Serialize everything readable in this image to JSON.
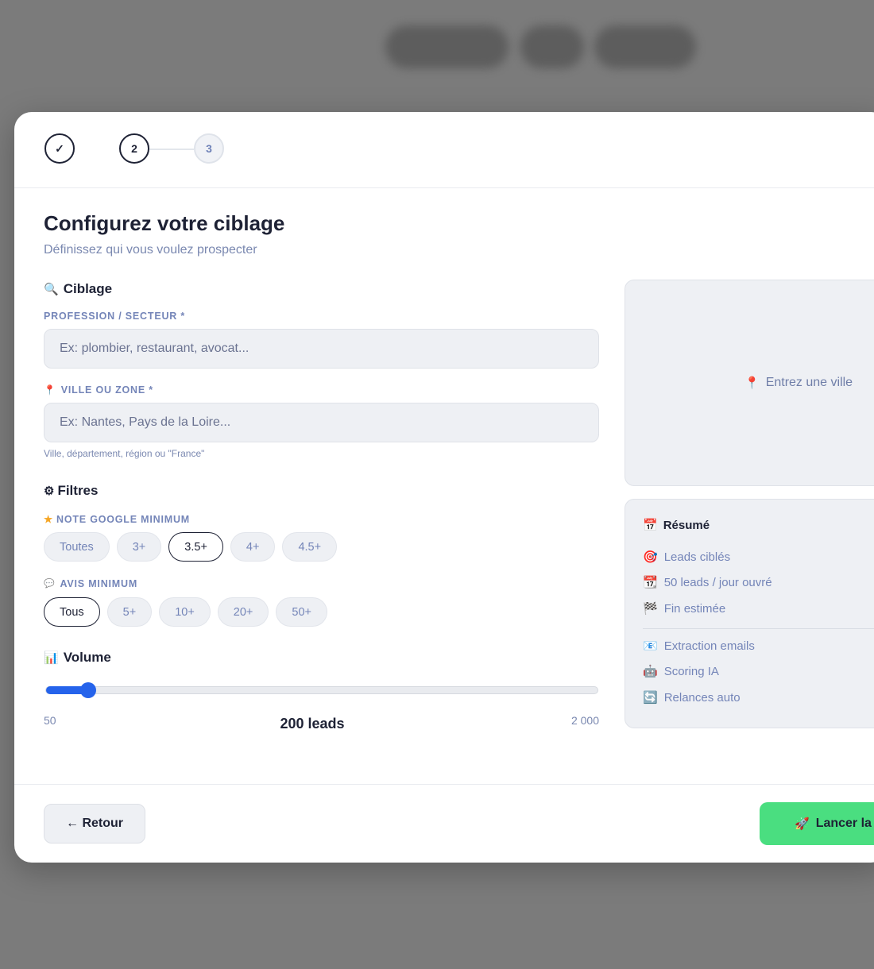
{
  "stepper": {
    "step1": "✓",
    "step2": "2",
    "step3": "3"
  },
  "header": {
    "title": "Configurez votre ciblage",
    "subtitle": "Définissez qui vous voulez prospecter"
  },
  "ciblage": {
    "heading": "Ciblage",
    "heading_icon": "🔍",
    "profession_label": "PROFESSION / SECTEUR *",
    "profession_placeholder": "Ex: plombier, restaurant, avocat...",
    "profession_value": "",
    "ville_label": "VILLE OU ZONE *",
    "ville_icon": "📍",
    "ville_placeholder": "Ex: Nantes, Pays de la Loire...",
    "ville_value": "",
    "ville_hint": "Ville, département, région ou \"France\""
  },
  "filtres": {
    "heading": "Filtres",
    "heading_icon": "⚙",
    "note_label": "NOTE GOOGLE MINIMUM",
    "note_icon": "★",
    "note_options": [
      "Toutes",
      "3+",
      "3.5+",
      "4+",
      "4.5+"
    ],
    "note_selected": "3.5+",
    "avis_label": "AVIS MINIMUM",
    "avis_icon": "💬",
    "avis_options": [
      "Tous",
      "5+",
      "10+",
      "20+",
      "50+"
    ],
    "avis_selected": "Tous"
  },
  "volume": {
    "heading": "Volume",
    "heading_icon": "📊",
    "min_label": "50",
    "max_label": "2 000",
    "value_label": "200 leads",
    "min": 50,
    "max": 2000,
    "value": 200
  },
  "map": {
    "icon": "📍",
    "text": "Entrez une ville"
  },
  "summary": {
    "title": "Résumé",
    "title_icon": "📅",
    "items": [
      {
        "icon": "🎯",
        "label": "Leads ciblés"
      },
      {
        "icon": "📆",
        "label": "50 leads / jour ouvré"
      },
      {
        "icon": "🏁",
        "label": "Fin estimée"
      }
    ],
    "features": [
      {
        "icon": "📧",
        "label": "Extraction emails"
      },
      {
        "icon": "🤖",
        "label": "Scoring IA"
      },
      {
        "icon": "🔄",
        "label": "Relances auto"
      }
    ]
  },
  "footer": {
    "back_label": "← Retour",
    "launch_icon": "🚀",
    "launch_label": "Lancer la"
  }
}
